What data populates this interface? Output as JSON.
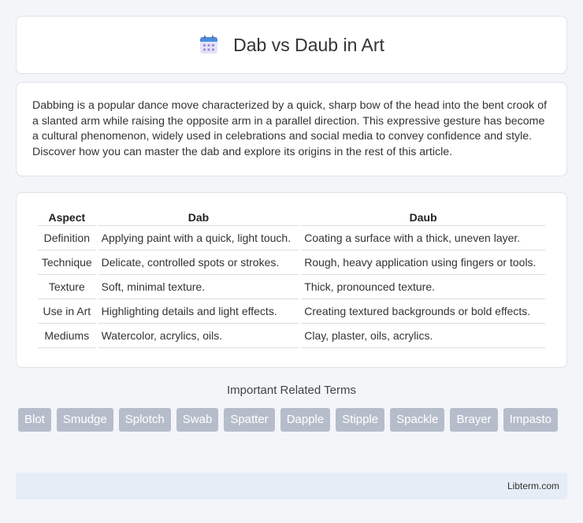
{
  "header": {
    "title": "Dab vs Daub in Art",
    "icon": "calendar-icon"
  },
  "intro": {
    "text": "Dabbing is a popular dance move characterized by a quick, sharp bow of the head into the bent crook of a slanted arm while raising the opposite arm in a parallel direction. This expressive gesture has become a cultural phenomenon, widely used in celebrations and social media to convey confidence and style. Discover how you can master the dab and explore its origins in the rest of this article."
  },
  "table": {
    "headers": [
      "Aspect",
      "Dab",
      "Daub"
    ],
    "rows": [
      [
        "Definition",
        "Applying paint with a quick, light touch.",
        "Coating a surface with a thick, uneven layer."
      ],
      [
        "Technique",
        "Delicate, controlled spots or strokes.",
        "Rough, heavy application using fingers or tools."
      ],
      [
        "Texture",
        "Soft, minimal texture.",
        "Thick, pronounced texture."
      ],
      [
        "Use in Art",
        "Highlighting details and light effects.",
        "Creating textured backgrounds or bold effects."
      ],
      [
        "Mediums",
        "Watercolor, acrylics, oils.",
        "Clay, plaster, oils, acrylics."
      ]
    ]
  },
  "related": {
    "title": "Important Related Terms",
    "tags": [
      "Blot",
      "Smudge",
      "Splotch",
      "Swab",
      "Spatter",
      "Dapple",
      "Stipple",
      "Spackle",
      "Brayer",
      "Impasto"
    ]
  },
  "footer": {
    "text": "Libterm.com"
  },
  "colors": {
    "tag_bg": "#b6bdca",
    "footer_bg": "#e6edf7",
    "icon_blue": "#4a8fe0",
    "icon_purple": "#9b8de0"
  }
}
